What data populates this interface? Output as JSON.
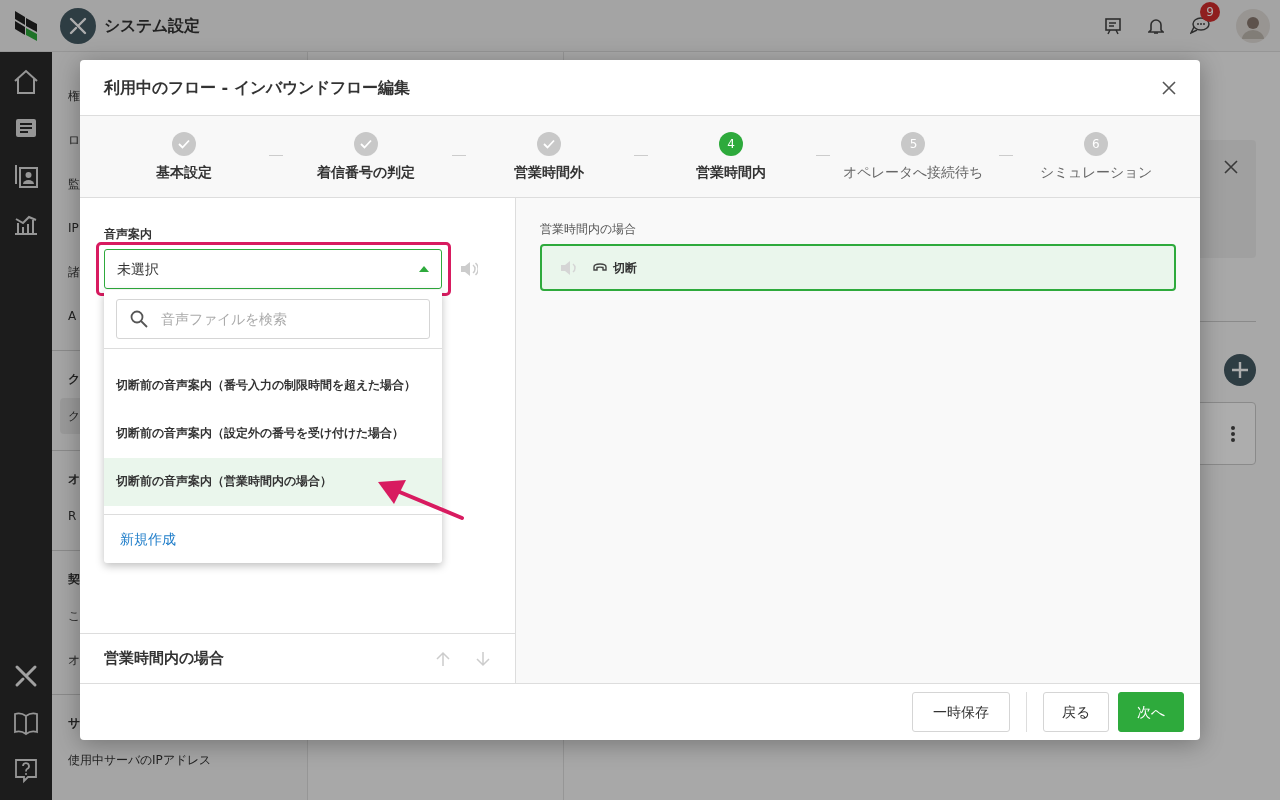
{
  "app_header": {
    "title": "システム設定",
    "notification_count": "9"
  },
  "background_sidebar": {
    "items": [
      {
        "label": "権",
        "kind": "item",
        "selected": false
      },
      {
        "label": "ロ",
        "kind": "item",
        "selected": false
      },
      {
        "label": "監",
        "kind": "item",
        "selected": false
      },
      {
        "label": "IP",
        "kind": "item",
        "selected": false
      },
      {
        "label": "諸",
        "kind": "item",
        "selected": false
      },
      {
        "label": "A",
        "kind": "item",
        "selected": false
      },
      {
        "label": "ク",
        "kind": "heading"
      },
      {
        "label": "ク",
        "kind": "item",
        "selected": true
      },
      {
        "label": "オ",
        "kind": "heading"
      },
      {
        "label": "R",
        "kind": "item",
        "selected": false
      },
      {
        "label": "契",
        "kind": "heading"
      },
      {
        "label": "こ",
        "kind": "item",
        "selected": false
      },
      {
        "label": "オ",
        "kind": "item",
        "selected": false
      },
      {
        "label": "サ",
        "kind": "heading"
      },
      {
        "label": "使用中サーバのIPアドレス",
        "kind": "item",
        "selected": false
      }
    ]
  },
  "modal": {
    "title": "利用中のフロー - インバウンドフロー編集",
    "steps": [
      {
        "label": "基本設定",
        "completed": true,
        "current": false
      },
      {
        "label": "着信番号の判定",
        "completed": true,
        "current": false
      },
      {
        "label": "営業時間外",
        "completed": true,
        "current": false
      },
      {
        "label": "営業時間内",
        "completed": false,
        "current": true,
        "number": "4"
      },
      {
        "label": "オペレータへ接続待ち",
        "completed": false,
        "current": false,
        "number": "5"
      },
      {
        "label": "シミュレーション",
        "completed": false,
        "current": false,
        "number": "6"
      }
    ],
    "field_label": "音声案内",
    "select": {
      "value": "未選択",
      "expanded": true
    },
    "dropdown": {
      "search_placeholder": "音声ファイルを検索",
      "options": [
        {
          "label": "切断前の音声案内（番号入力の制限時間を超えた場合）",
          "selected": false
        },
        {
          "label": "切断前の音声案内（設定外の番号を受け付けた場合）",
          "selected": false
        },
        {
          "label": "切断前の音声案内（営業時間内の場合）",
          "selected": true
        }
      ],
      "create_link": "新規作成"
    },
    "section_title": "営業時間内の場合",
    "preview": {
      "label": "営業時間内の場合",
      "action": "切断",
      "selected": true
    },
    "buttons": [
      {
        "label": "一時保存",
        "kind": "secondary"
      },
      {
        "label": "戻る",
        "kind": "secondary"
      },
      {
        "label": "次へ",
        "kind": "primary"
      }
    ]
  }
}
